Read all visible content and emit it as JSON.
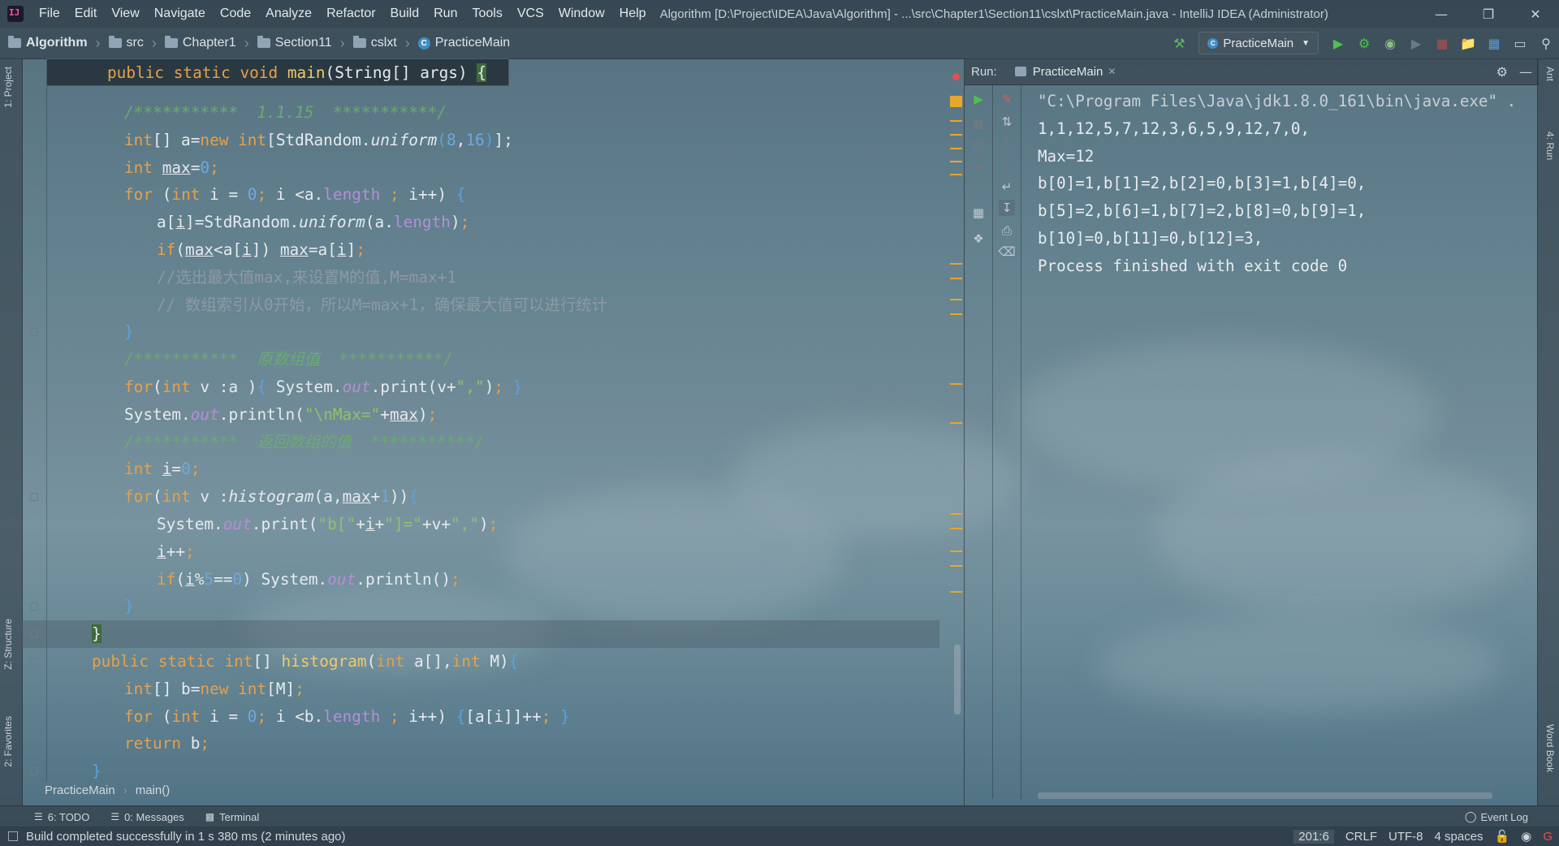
{
  "menubar": {
    "items": [
      "File",
      "Edit",
      "View",
      "Navigate",
      "Code",
      "Analyze",
      "Refactor",
      "Build",
      "Run",
      "Tools",
      "VCS",
      "Window",
      "Help"
    ],
    "title": "Algorithm [D:\\Project\\IDEA\\Java\\Algorithm] - ...\\src\\Chapter1\\Section11\\cslxt\\PracticeMain.java - IntelliJ IDEA (Administrator)",
    "controls": [
      "minimize-icon",
      "restore-icon",
      "close-icon"
    ]
  },
  "navbar": {
    "crumbs": [
      "Algorithm",
      "src",
      "Chapter1",
      "Section11",
      "cslxt",
      "PracticeMain"
    ],
    "run_config": "PracticeMain"
  },
  "side_tabs": {
    "left": [
      "1: Project",
      "Z: Structure",
      "2: Favorites"
    ],
    "right": [
      "Ant",
      "4: Run",
      "Word Book"
    ]
  },
  "editor": {
    "sticky_header": "public static void main(String[] args) {",
    "breadcrumbs": [
      "PracticeMain",
      "main()"
    ],
    "lines": [
      "/***********  1.1.15  ***********/",
      "int[] a=new int[StdRandom.uniform(8,16)];",
      "int max=0;",
      "for (int i = 0; i <a.length ; i++) {",
      "a[i]=StdRandom.uniform(a.length);",
      "if(max<a[i]) max=a[i];",
      "//选出最大值max,来设置M的值,M=max+1",
      "// 数组索引从0开始，所以M=max+1，确保最大值可以进行统计",
      "}",
      "/***********  原数组值  ***********/",
      "for(int v :a ){ System.out.print(v+\",\"); }",
      "System.out.println(\"\\nMax=\"+max);",
      "/***********  返回数组的值  ***********/",
      "int i=0;",
      "for(int v :histogram(a,max+1)){",
      "System.out.print(\"b[\"+i+\"]=\"+v+\",\");",
      "i++;",
      "if(i%5==0) System.out.println();",
      "}",
      "}",
      "public static int[] histogram(int a[],int M){",
      "int[] b=new int[M];",
      "for (int i = 0; i <b.length ; i++) {[a[i]]++; }",
      "return b;",
      "}"
    ]
  },
  "run_panel": {
    "label": "Run:",
    "tab": "PracticeMain",
    "console": [
      "\"C:\\Program Files\\Java\\jdk1.8.0_161\\bin\\java.exe\" .",
      "1,1,12,5,7,12,3,6,5,9,12,7,0,",
      "Max=12",
      "b[0]=1,b[1]=2,b[2]=0,b[3]=1,b[4]=0,",
      "b[5]=2,b[6]=1,b[7]=2,b[8]=0,b[9]=1,",
      "b[10]=0,b[11]=0,b[12]=3,",
      "Process finished with exit code 0"
    ]
  },
  "toolwindows": {
    "todo": "6: TODO",
    "messages": "0: Messages",
    "terminal": "Terminal",
    "event_log": "Event Log"
  },
  "status": {
    "message": "Build completed successfully in 1 s 380 ms (2 minutes ago)",
    "position": "201:6",
    "line_sep": "CRLF",
    "encoding": "UTF-8",
    "indent": "4 spaces"
  },
  "colors": {
    "keyword": "#e5a14b",
    "string": "#8fc26a",
    "number": "#6fa8dc",
    "comment": "#8c9aa4",
    "javadoc": "#6aab73",
    "field": "#b58ed6",
    "method_decl": "#f0c96a",
    "marker": "#e6a72a"
  }
}
